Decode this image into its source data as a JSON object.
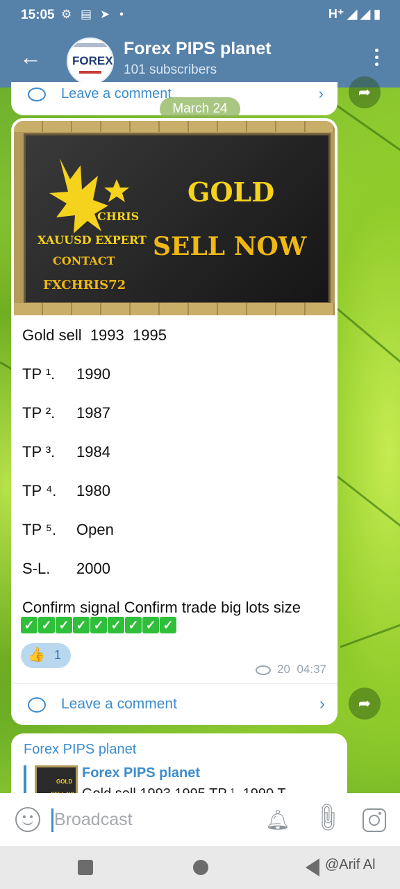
{
  "status_bar": {
    "time": "15:05",
    "network": "H⁺"
  },
  "header": {
    "channel_name": "Forex PIPS planet",
    "subscribers": "101 subscribers",
    "avatar_text": "FOREX"
  },
  "top_comment": {
    "label": "Leave a comment"
  },
  "date_pill": "March 24",
  "banner": {
    "gold": "GOLD",
    "sell_now": "SELL NOW",
    "chris": "CHRIS",
    "line1": "XAUUSD EXPERT",
    "line2": "CONTACT",
    "line3": "FXCHRIS72"
  },
  "message": {
    "headline": "Gold sell  1993  1995",
    "rows": [
      {
        "label": "TP ¹.",
        "value": "1990"
      },
      {
        "label": "TP ².",
        "value": "1987"
      },
      {
        "label": "TP ³.",
        "value": "1984"
      },
      {
        "label": "TP ⁴.",
        "value": "1980"
      },
      {
        "label": "TP ⁵.",
        "value": "Open"
      },
      {
        "label": "S-L.",
        "value": "2000"
      }
    ],
    "confirm": "Confirm signal Confirm trade big lots size",
    "checkmarks": [
      "✓",
      "✓",
      "✓",
      "✓",
      "✓",
      "✓",
      "✓",
      "✓",
      "✓"
    ],
    "reaction": {
      "emoji": "👍",
      "count": "1"
    },
    "views": "20",
    "time": "04:37",
    "comment_label": "Leave a comment"
  },
  "next_message": {
    "author": "Forex PIPS planet",
    "quote_author": "Forex PIPS planet",
    "quote_text": "Gold sell  1993  1995  TP ¹.    1990  T",
    "thumb_gold": "GOLD",
    "thumb_sell": "SELL NO"
  },
  "input": {
    "placeholder": "Broadcast"
  },
  "watermark": "@Arif Al",
  "colors": {
    "header_bg": "#5681a9",
    "link": "#3d8ccc",
    "check_green": "#2fbf3a"
  }
}
